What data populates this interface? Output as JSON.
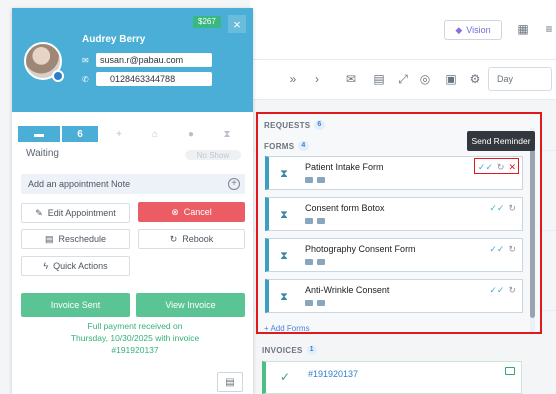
{
  "header_actions": {
    "vision_label": "Vision",
    "day_label": "Day"
  },
  "patient": {
    "name": "Audrey Berry",
    "amount_badge": "$267",
    "email": "susan.r@pabau.com",
    "phone": "0128463344788"
  },
  "status": {
    "current": "Waiting",
    "no_show_label": "No Show",
    "step_count": "6"
  },
  "note": {
    "placeholder": "Add an appointment Note"
  },
  "actions": {
    "edit": "Edit Appointment",
    "cancel": "Cancel",
    "reschedule": "Reschedule",
    "rebook": "Rebook",
    "quick": "Quick Actions",
    "invoice_sent": "Invoice Sent",
    "view_invoice": "View Invoice"
  },
  "payment": {
    "line1": "Full payment received on",
    "line2": "Thursday, 10/30/2025 with invoice",
    "line3": "#191920137"
  },
  "requests": {
    "label": "REQUESTS",
    "count": "6"
  },
  "forms": {
    "label": "FORMS",
    "count": "4",
    "items": [
      "Patient Intake Form",
      "Consent form Botox",
      "Photography Consent Form",
      "Anti-Wrinkle Consent"
    ],
    "add_label": "+ Add Forms",
    "tooltip": "Send Reminder"
  },
  "invoices": {
    "label": "INVOICES",
    "count": "1",
    "items": [
      "#191920137"
    ]
  },
  "colors": {
    "header": "#4aaed6",
    "cancel": "#eb5c64",
    "green": "#5ac494",
    "highlight": "#e0191f"
  }
}
